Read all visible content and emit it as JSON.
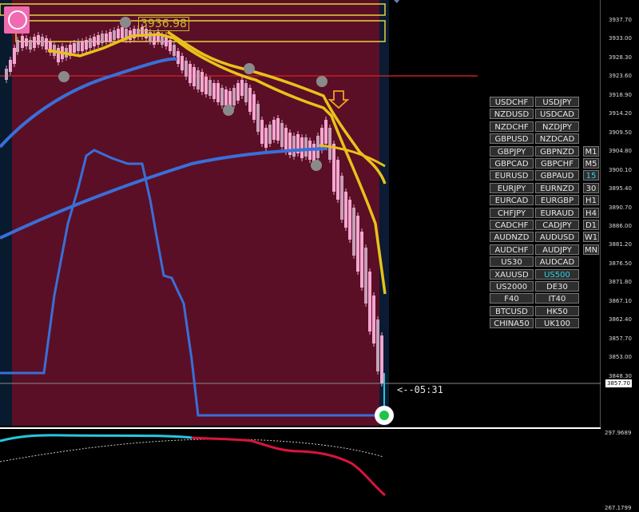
{
  "logo": {
    "icon": "indicator-logo-icon"
  },
  "top_level_label": "3936.98",
  "countdown": "<--05:31",
  "price_axis": [
    "3937.70",
    "3933.00",
    "3928.30",
    "3923.60",
    "3918.90",
    "3914.20",
    "3909.50",
    "3904.80",
    "3900.10",
    "3895.40",
    "3890.70",
    "3886.00",
    "3881.20",
    "3876.50",
    "3871.80",
    "3867.10",
    "3862.40",
    "3857.70",
    "3853.00",
    "3848.30"
  ],
  "current_price": "3857.70",
  "sub_axis": {
    "top": "297.9689",
    "bottom": "267.1799"
  },
  "symbols": [
    [
      "USDCHF",
      "USDJPY"
    ],
    [
      "NZDUSD",
      "USDCAD"
    ],
    [
      "NZDCHF",
      "NZDJPY"
    ],
    [
      "GBPUSD",
      "NZDCAD"
    ],
    [
      "GBPJPY",
      "GBPNZD"
    ],
    [
      "GBPCAD",
      "GBPCHF"
    ],
    [
      "EURUSD",
      "GBPAUD"
    ],
    [
      "EURJPY",
      "EURNZD"
    ],
    [
      "EURCAD",
      "EURGBP"
    ],
    [
      "CHFJPY",
      "EURAUD"
    ],
    [
      "CADCHF",
      "CADJPY"
    ],
    [
      "AUDNZD",
      "AUDUSD"
    ],
    [
      "AUDCHF",
      "AUDJPY"
    ],
    [
      "US30",
      "AUDCAD"
    ],
    [
      "XAUUSD",
      "US500"
    ],
    [
      "US2000",
      "DE30"
    ],
    [
      "F40",
      "IT40"
    ],
    [
      "BTCUSD",
      "HK50"
    ],
    [
      "CHINA50",
      "UK100"
    ]
  ],
  "active_symbol": "US500",
  "timeframes": [
    "M1",
    "M5",
    "15",
    "30",
    "H1",
    "H4",
    "D1",
    "W1",
    "MN"
  ],
  "active_timeframe": "15",
  "colors": {
    "background": "#000000",
    "zone": "#5a0f26",
    "ma_fast": "#e8c21a",
    "ma_slow": "#3a6fd8",
    "bull": "#f3a6cf",
    "bear": "#c8a0b8",
    "osc_up": "#27c6df",
    "osc_down": "#d9143c",
    "red_line": "#c81d25"
  }
}
